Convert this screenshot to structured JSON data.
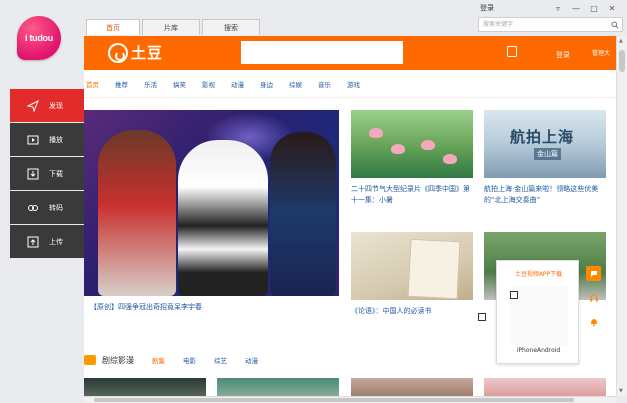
{
  "app": {
    "logo_text": "i tudou",
    "window_title": "登录",
    "window_buttons": [
      "▿",
      "—",
      "□",
      "✕"
    ],
    "search_placeholder": "搜索关键字"
  },
  "sidebar": {
    "items": [
      {
        "label": "发现",
        "icon": "paper-plane-icon",
        "active": true
      },
      {
        "label": "播放",
        "icon": "play-icon",
        "active": false
      },
      {
        "label": "下载",
        "icon": "download-icon",
        "active": false
      },
      {
        "label": "转码",
        "icon": "link-icon",
        "active": false
      },
      {
        "label": "上传",
        "icon": "upload-icon",
        "active": false
      }
    ]
  },
  "tabs": [
    {
      "label": "首页",
      "active": true
    },
    {
      "label": "片库",
      "active": false
    },
    {
      "label": "搜索",
      "active": false
    }
  ],
  "site": {
    "logo_text": "土豆",
    "login": "登录",
    "manage": "管理大",
    "brand_color": "#ff6a00"
  },
  "subnav": [
    "首页",
    "推荐",
    "乐活",
    "搞笑",
    "影视",
    "动漫",
    "身边",
    "综娱",
    "音乐",
    "游戏"
  ],
  "hero_caption": "【原创】四强争冠出奇招竟呆李宇春",
  "cards": [
    {
      "caption": "二十四节气大型纪录片《四季中国》第十一集：小暑"
    },
    {
      "caption": "航拍上海·金山篇来啦！领略这些优美的“北上海交奏曲”",
      "overlay_title": "航拍上海",
      "overlay_sub": "金山篇"
    },
    {
      "caption": "《论语》：中国人的必读书"
    }
  ],
  "section": {
    "title": "剧综影漫",
    "tabs": [
      "剧集",
      "电影",
      "综艺",
      "动漫"
    ]
  },
  "popup": {
    "title": "土豆视频APP下载",
    "platforms": "iPhoneAndroid"
  }
}
